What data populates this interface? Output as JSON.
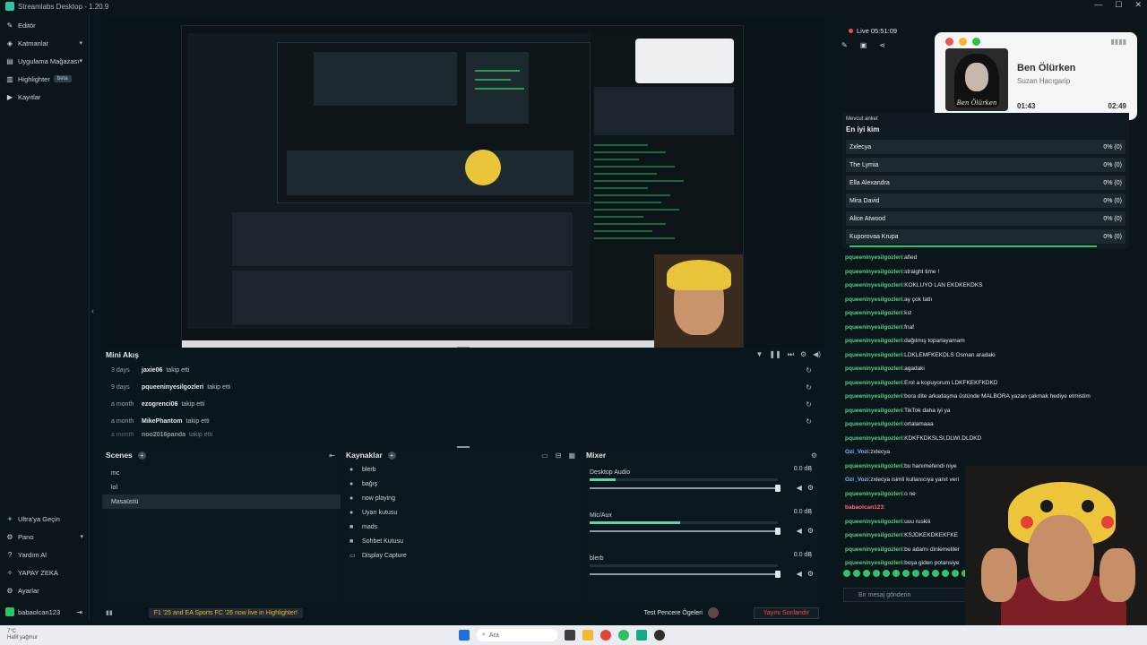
{
  "window": {
    "title": "Streamlabs Desktop - 1.20.9"
  },
  "sidebar": {
    "items": [
      {
        "label": "Editör",
        "icon": "pencil-icon"
      },
      {
        "label": "Katmanlar",
        "icon": "layers-icon"
      },
      {
        "label": "Uygulama Mağazası",
        "icon": "store-icon"
      },
      {
        "label": "Highlighter",
        "icon": "highlighter-icon",
        "badge": "beta"
      },
      {
        "label": "Kayıtlar",
        "icon": "recordings-icon"
      }
    ],
    "bottom": [
      {
        "label": "Ultra'ya Geçin",
        "icon": "ultra-icon"
      },
      {
        "label": "Pano",
        "icon": "dashboard-icon"
      },
      {
        "label": "Yardım Al",
        "icon": "help-icon"
      },
      {
        "label": "YAPAY ZEKA",
        "icon": "ai-icon"
      },
      {
        "label": "Ayarlar",
        "icon": "gear-icon"
      }
    ],
    "user": "babaolcan123"
  },
  "mini_feed": {
    "title": "Mini Akış",
    "rows": [
      {
        "when": "3 days",
        "who": "jaxie06",
        "what": "takip etti"
      },
      {
        "when": "9 days",
        "who": "pqueeninyesilgozleri",
        "what": "takip etti"
      },
      {
        "when": "a month",
        "who": "ezogrenci06",
        "what": "takip etti"
      },
      {
        "when": "a month",
        "who": "MikePhantom",
        "what": "takip etti"
      },
      {
        "when": "a month",
        "who": "noo2016panda",
        "what": "takip etti"
      }
    ]
  },
  "scenes": {
    "title": "Scenes",
    "items": [
      "mc",
      "lol",
      "Masaüstü"
    ],
    "selected": 2
  },
  "sources": {
    "title": "Kaynaklar",
    "items": [
      "blerb",
      "bağış",
      "now playing",
      "Uyarı kutusu",
      "mads",
      "Sohbet Kutusu",
      "Display Capture"
    ]
  },
  "mixer": {
    "title": "Mixer",
    "channels": [
      {
        "name": "Desktop Audio",
        "db": "0.0 dB",
        "level": 0.14,
        "volume": 1.0
      },
      {
        "name": "Mic/Aux",
        "db": "0.0 dB",
        "level": 0.48,
        "volume": 1.0
      },
      {
        "name": "blerb",
        "db": "0.0 dB",
        "level": 0.0,
        "volume": 1.0
      }
    ]
  },
  "statusbar": {
    "news": "F1 '25 and EA Sports FC '26 now live in Highlighter!",
    "test": "Test Pencere Ögeleri",
    "end": "Yayını Sonlandır"
  },
  "right": {
    "live": "Live 05:51:09",
    "now_playing": {
      "title": "Ben Ölürken",
      "artist": "Suzan Hacıgarip",
      "current": "01:43",
      "total": "02:49",
      "progress": 0.61,
      "cover_text": "Ben Ölürken"
    },
    "poll": {
      "label": "Mevcut anket",
      "question": "En iyi kim",
      "options": [
        {
          "name": "Zxlecya",
          "pct": "0% (0)"
        },
        {
          "name": "The Lymia",
          "pct": "0% (0)"
        },
        {
          "name": "Ella Alexandra",
          "pct": "0% (0)"
        },
        {
          "name": "Mira David",
          "pct": "0% (0)"
        },
        {
          "name": "Alice Atwood",
          "pct": "0% (0)"
        },
        {
          "name": "Kuporovaa Krupa",
          "pct": "0% (0)"
        }
      ]
    },
    "chat": [
      {
        "user": "pqueeninyesilgozleri",
        "text": "afied"
      },
      {
        "user": "pqueeninyesilgozleri",
        "text": "straight time !"
      },
      {
        "user": "pqueeninyesilgozleri",
        "text": "KOKLUYO LAN EKDKEKDKS"
      },
      {
        "user": "pqueeninyesilgozleri",
        "text": "ay çok tatlı"
      },
      {
        "user": "pqueeninyesilgozleri",
        "text": "kız"
      },
      {
        "user": "pqueeninyesilgozleri",
        "text": "fnaf"
      },
      {
        "user": "pqueeninyesilgozleri",
        "text": "dağılmış toparlayamam"
      },
      {
        "user": "pqueeninyesilgozleri",
        "text": "LDKLEMFKEKDLS Osman aradaki"
      },
      {
        "user": "pqueeninyesilgozleri",
        "text": "agadaki"
      },
      {
        "user": "pqueeninyesilgozleri",
        "text": "Erol a kopuyorum LDKFKEKFKDKD"
      },
      {
        "user": "pqueeninyesilgozleri",
        "text": "bora dite arkadaşma üstünde MALBORA yazan çakmak hediye etmistim"
      },
      {
        "user": "pqueeninyesilgozleri",
        "text": "TikTok daha iyi ya"
      },
      {
        "user": "pqueeninyesilgozleri",
        "text": "ortalamaaa"
      },
      {
        "user": "pqueeninyesilgozleri",
        "text": "KDKFKDKSLSI.DLWI.DLDKD"
      },
      {
        "user": "Ozi_Vozi",
        "text": "zxlecya",
        "style": "u2"
      },
      {
        "user": "pqueeninyesilgozleri",
        "text": "bu hanımefendi niye"
      },
      {
        "user": "Ozi_Vozi",
        "text": "zxlecya isimli kullanıcıya yanıt veri",
        "style": "u2"
      },
      {
        "user": "pqueeninyesilgozleri",
        "text": "o ne"
      },
      {
        "user": "babaolcan123",
        "text": "",
        "style": "u3"
      },
      {
        "user": "pqueeninyesilgozleri",
        "text": "uuu ruskiii"
      },
      {
        "user": "pqueeninyesilgozleri",
        "text": "KSJDKEKDKEKFKE"
      },
      {
        "user": "pqueeninyesilgozleri",
        "text": "bu adamı dinlemeliler"
      },
      {
        "user": "pqueeninyesilgozleri",
        "text": "boşa giden potansiye"
      }
    ],
    "input_placeholder": "Bir mesaj gönderin"
  },
  "taskbar": {
    "search": "Ara",
    "weather_temp": "7°C",
    "weather_desc": "Hafif yağmur"
  }
}
